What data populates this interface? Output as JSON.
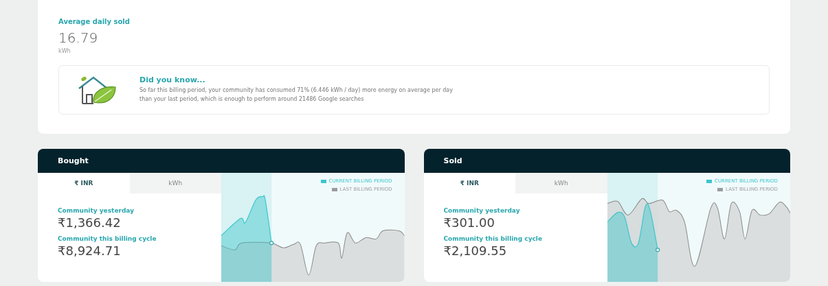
{
  "summary": {
    "label": "Average daily sold",
    "value": "16.79",
    "unit": "kWh"
  },
  "tip": {
    "title": "Did you know...",
    "text": "So far this billing period, your community has consumed 71% (6.446 kWh / day) more energy on average per day than your last period, which is enough to perform around 21486 Google searches"
  },
  "panels": [
    {
      "title": "Bought",
      "tabs": [
        {
          "label": "₹ INR",
          "selected": true
        },
        {
          "label": "kWh",
          "selected": false
        }
      ],
      "stats": [
        {
          "label": "Community yesterday",
          "value": "₹1,366.42"
        },
        {
          "label": "Community this billing cycle",
          "value": "₹8,924.71"
        }
      ],
      "legend": [
        {
          "label": "CURRENT BILLING PERIOD",
          "color": "#3cc6cc"
        },
        {
          "label": "LAST BILLING PERIOD",
          "color": "#9b9b9b"
        }
      ]
    },
    {
      "title": "Sold",
      "tabs": [
        {
          "label": "₹ INR",
          "selected": true
        },
        {
          "label": "kWh",
          "selected": false
        }
      ],
      "stats": [
        {
          "label": "Community yesterday",
          "value": "₹301.00"
        },
        {
          "label": "Community this billing cycle",
          "value": "₹2,109.55"
        }
      ],
      "legend": [
        {
          "label": "CURRENT BILLING PERIOD",
          "color": "#3cc6cc"
        },
        {
          "label": "LAST BILLING PERIOD",
          "color": "#9b9b9b"
        }
      ]
    }
  ]
}
